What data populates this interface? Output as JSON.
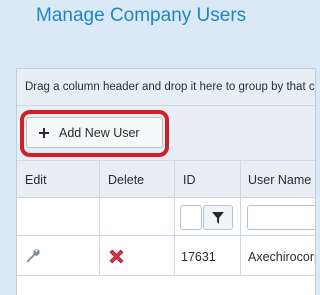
{
  "page": {
    "title": "Manage Company Users"
  },
  "grid": {
    "group_hint": "Drag a column header and drop it here to group by that column",
    "toolbar": {
      "add_label": "Add New User",
      "add_icon": "plus-icon",
      "highlight_color": "#d21f26"
    },
    "columns": [
      "Edit",
      "Delete",
      "ID",
      "User Name"
    ],
    "filter": {
      "id_value": "",
      "username_value": "",
      "filter_icon": "filter-icon"
    },
    "rows": [
      {
        "edit_icon": "wrench-icon",
        "delete_icon": "delete-x-icon",
        "id": "17631",
        "username": "Axechirocorp"
      }
    ]
  },
  "colors": {
    "title": "#1d86c8",
    "background": "#dbe9f7",
    "delete": "#d21f26"
  }
}
